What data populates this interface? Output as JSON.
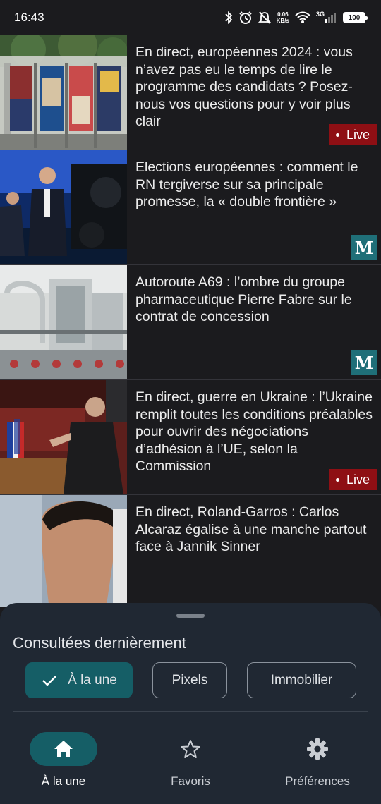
{
  "status_bar": {
    "time": "16:43",
    "speed_value": "0.06",
    "speed_unit": "KB/s",
    "network": "3G",
    "battery": "100"
  },
  "articles": [
    {
      "title": "En direct, européennes 2024 : vous n’avez pas eu le temps de lire le programme des candidats ? Posez-nous vos questions pour y voir plus clair",
      "badge": "Live"
    },
    {
      "title": "Elections européennes : comment le RN tergiverse sur sa principale promesse, la « double frontière »",
      "badge": "M"
    },
    {
      "title": "Autoroute A69 : l’ombre du groupe pharmaceutique Pierre Fabre sur le contrat de concession",
      "badge": "M"
    },
    {
      "title": "En direct, guerre en Ukraine : l’Ukraine remplit toutes les conditions préalables pour ouvrir des négociations d’adhésion à l’UE, selon la Commission",
      "badge": "Live"
    },
    {
      "title": "En direct, Roland-Garros : Carlos Alcaraz égalise à une manche partout face à Jannik Sinner",
      "badge": ""
    }
  ],
  "recent": {
    "title": "Consultées dernièrement",
    "chips": [
      "À la une",
      "Pixels",
      "Immobilier"
    ]
  },
  "nav": {
    "items": [
      "À la une",
      "Favoris",
      "Préférences"
    ]
  },
  "colors": {
    "accent": "#155e66",
    "live_badge": "#8e0f14",
    "lemonde_badge": "#1f6f78",
    "sheet_bg": "#202833",
    "feed_bg": "#1b1b1e"
  },
  "icons": {
    "bluetooth": "bluetooth-icon",
    "alarm": "alarm-icon",
    "mute": "bell-off-icon",
    "wifi": "wifi-icon",
    "signal": "signal-icon",
    "home": "home-icon",
    "star": "star-icon",
    "gear": "gear-icon",
    "check": "check-icon"
  }
}
